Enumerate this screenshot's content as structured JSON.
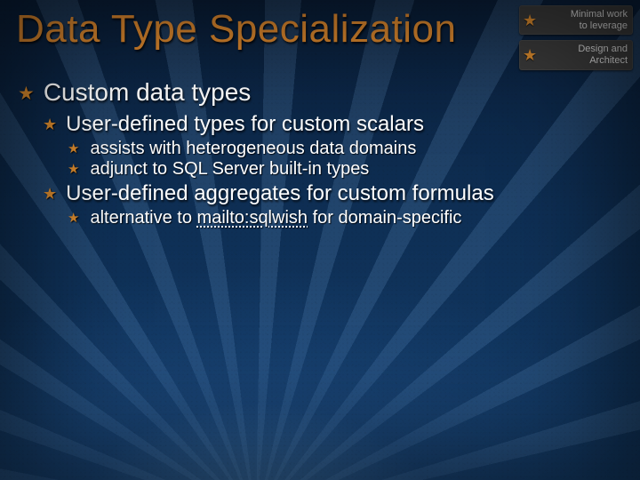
{
  "title": "Data Type Specialization",
  "badges": [
    {
      "line1": "Minimal work",
      "line2": "to leverage"
    },
    {
      "line1": "Design and",
      "line2": "Architect"
    }
  ],
  "content": {
    "lvl1": {
      "text": "Custom data types",
      "children": [
        {
          "text": "User-defined types for custom scalars",
          "children": [
            {
              "text": "assists with heterogeneous data domains"
            },
            {
              "text": "adjunct to SQL Server built-in types"
            }
          ]
        },
        {
          "text": "User-defined aggregates for custom formulas",
          "children": [
            {
              "prefix": "alternative to ",
              "link": "mailto:sqlwish",
              "suffix": " for domain-specific"
            }
          ]
        }
      ]
    }
  }
}
